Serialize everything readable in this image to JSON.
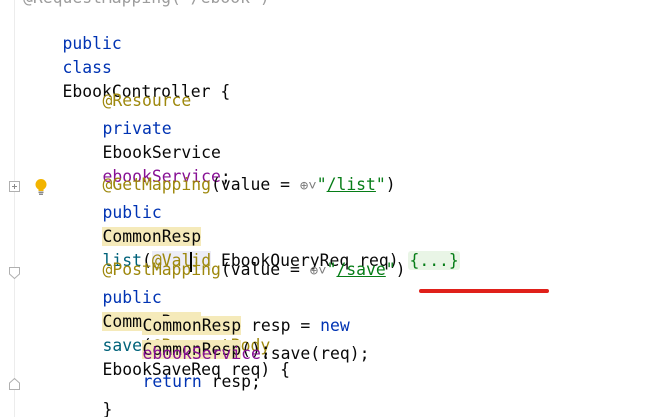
{
  "editor": {
    "top_clipped": "@RequestMapping(\"/ebook\")",
    "lines": {
      "class_decl": {
        "kw_public": "public",
        "kw_class": "class",
        "name": "EbookController",
        "brace": " {"
      },
      "resource_ann": "@Resource",
      "field_decl": {
        "kw_private": "private",
        "type": "EbookService",
        "name": "ebookService",
        "end": ";"
      },
      "get_mapping": {
        "ann": "@GetMapping",
        "open": "(value = ",
        "globe": "⊕˅",
        "quote1": "\"",
        "path": "/list",
        "quote2": "\"",
        "close": ")"
      },
      "list_method": {
        "kw_public": "public",
        "ret_type": "CommonResp",
        "name": "list",
        "open": "(",
        "ann_valid_a": "@Val",
        "ann_valid_b": "id",
        "param": " EbookQueryReq req) ",
        "folded_body": "{...}"
      },
      "post_mapping": {
        "ann": "@PostMapping",
        "open": "(value = ",
        "globe": "⊕˅",
        "quote1": "\"",
        "path": "/save",
        "quote2": "\"",
        "close": ")"
      },
      "save_method": {
        "kw_public": "public",
        "ret_type": "CommonResp",
        "name": "save",
        "open": "(",
        "ann_request_body": "@RequestBody",
        "param_type": "EbookSaveReq",
        "param_rest": " req) {"
      },
      "resp_decl": {
        "type": "CommonResp",
        "mid": " resp = ",
        "kw_new": "new",
        "ctor": "CommonResp",
        "end": "();"
      },
      "save_call": {
        "field": "ebookService",
        "rest": ".save(req);"
      },
      "return_stmt": {
        "kw_return": "return",
        "rest": " resp;"
      },
      "close_brace": "}"
    },
    "icons": {
      "bulb": "lightbulb-icon",
      "fold": "fold-toggle-icon"
    },
    "colors": {
      "keyword": "#0033b3",
      "annotation": "#9e880d",
      "field": "#871094",
      "string": "#067d17",
      "method": "#00627a",
      "usage_highlight": "#f5eaba",
      "error_underline": "#e0201a"
    }
  }
}
